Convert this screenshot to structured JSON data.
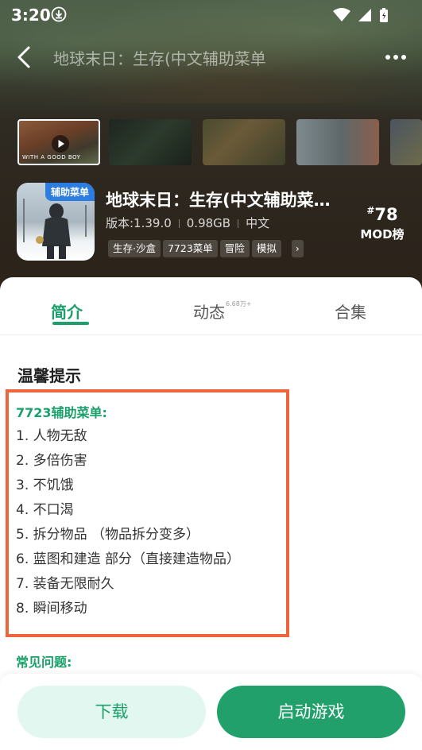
{
  "status_bar": {
    "time": "3:20"
  },
  "nav": {
    "title": "地球末日：生存(中文辅助菜单"
  },
  "thumbnails": [
    {
      "caption": "WITH A GOOD BOY"
    },
    {
      "caption": ""
    },
    {
      "caption": ""
    },
    {
      "caption": ""
    },
    {
      "caption": ""
    }
  ],
  "app": {
    "icon_badge": "辅助菜单",
    "title": "地球末日：生存(中文辅助菜单)",
    "version": "版本:1.39.0",
    "size": "0.98GB",
    "language": "中文",
    "tags": [
      "生存·沙盒",
      "7723菜单",
      "冒险",
      "模拟"
    ],
    "rank_hash": "#",
    "rank_number": "78",
    "rank_label": "MOD榜"
  },
  "tabs": [
    {
      "label": "简介",
      "sup": ""
    },
    {
      "label": "动态",
      "sup": "6.68万+"
    },
    {
      "label": "合集",
      "sup": ""
    }
  ],
  "content": {
    "section_title": "温馨提示",
    "menu_heading": "7723辅助菜单:",
    "menu_items": [
      "1. 人物无敌",
      "2. 多倍伤害",
      "3. 不饥饿",
      "4. 不口渴",
      "5. 拆分物品 （物品拆分变多）",
      "6. 蓝图和建造 部分（直接建造物品）",
      "7. 装备无限耐久",
      "8. 瞬间移动"
    ],
    "faq_heading": "常见问题:"
  },
  "actions": {
    "download": "下载",
    "launch": "启动游戏"
  },
  "colors": {
    "accent": "#1aa06a",
    "highlight_border": "#f0643c",
    "hero_bg": "#2b2219"
  }
}
